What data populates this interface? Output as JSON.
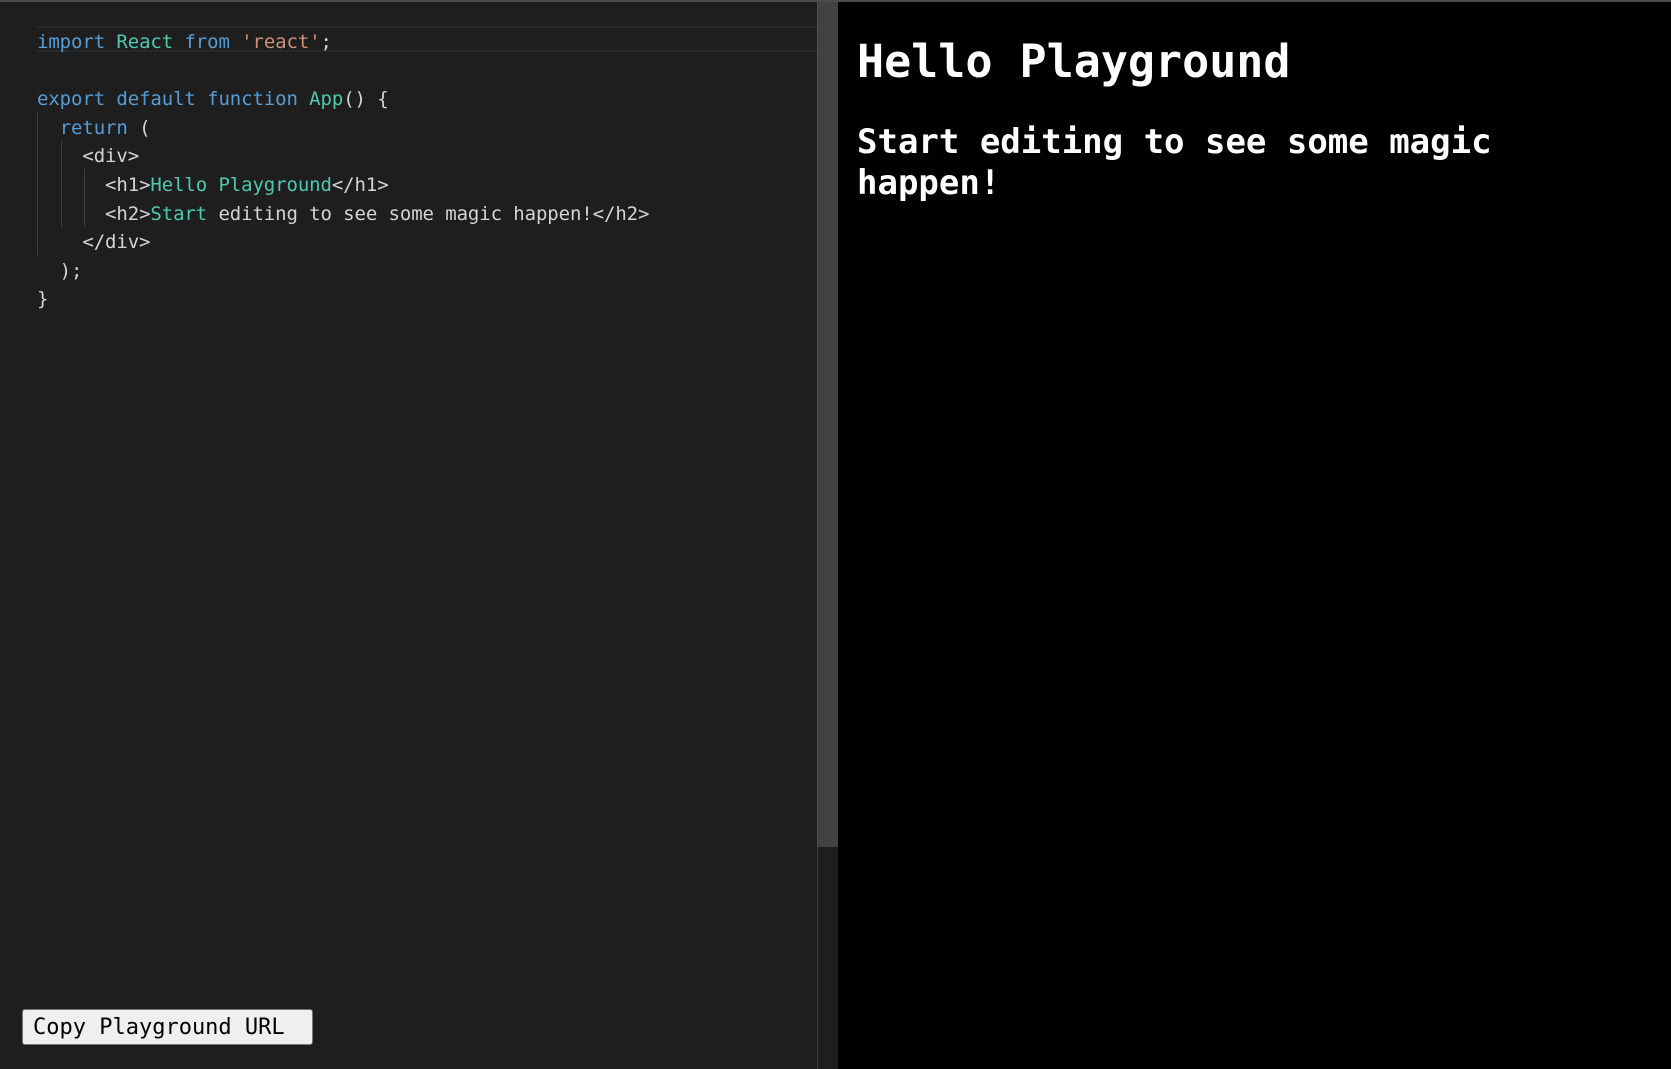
{
  "editor": {
    "language": "jsx",
    "lines": [
      [
        {
          "t": "kw",
          "v": "import"
        },
        {
          "t": "txt",
          "v": " "
        },
        {
          "t": "id",
          "v": "React"
        },
        {
          "t": "txt",
          "v": " "
        },
        {
          "t": "kw",
          "v": "from"
        },
        {
          "t": "txt",
          "v": " "
        },
        {
          "t": "str",
          "v": "'react'"
        },
        {
          "t": "txt",
          "v": ";"
        }
      ],
      [],
      [
        {
          "t": "kw",
          "v": "export"
        },
        {
          "t": "txt",
          "v": " "
        },
        {
          "t": "kw",
          "v": "default"
        },
        {
          "t": "txt",
          "v": " "
        },
        {
          "t": "kw",
          "v": "function"
        },
        {
          "t": "txt",
          "v": " "
        },
        {
          "t": "id",
          "v": "App"
        },
        {
          "t": "txt",
          "v": "() {"
        }
      ],
      [
        {
          "t": "txt",
          "v": "  "
        },
        {
          "t": "kw",
          "v": "return"
        },
        {
          "t": "txt",
          "v": " ("
        }
      ],
      [
        {
          "t": "txt",
          "v": "    "
        },
        {
          "t": "tag",
          "v": "<div>"
        }
      ],
      [
        {
          "t": "txt",
          "v": "      "
        },
        {
          "t": "tag",
          "v": "<h1>"
        },
        {
          "t": "id",
          "v": "Hello Playground"
        },
        {
          "t": "tag",
          "v": "</h1>"
        }
      ],
      [
        {
          "t": "txt",
          "v": "      "
        },
        {
          "t": "tag",
          "v": "<h2>"
        },
        {
          "t": "id",
          "v": "Start"
        },
        {
          "t": "txt",
          "v": " editing to see some magic happen!"
        },
        {
          "t": "tag",
          "v": "</h2>"
        }
      ],
      [
        {
          "t": "txt",
          "v": "    "
        },
        {
          "t": "tag",
          "v": "</div>"
        }
      ],
      [
        {
          "t": "txt",
          "v": "  );"
        }
      ],
      [
        {
          "t": "txt",
          "v": "}"
        }
      ]
    ],
    "colors": {
      "keyword": "#569cd6",
      "identifier": "#4ec9b0",
      "string": "#ce9178",
      "text": "#d4d4d4",
      "background": "#1e1e1e"
    }
  },
  "toolbar": {
    "copy_url_label": "Copy Playground URL"
  },
  "preview": {
    "h1": "Hello Playground",
    "h2": "Start editing to see some magic happen!",
    "background": "#000000",
    "text_color": "#ffffff"
  }
}
